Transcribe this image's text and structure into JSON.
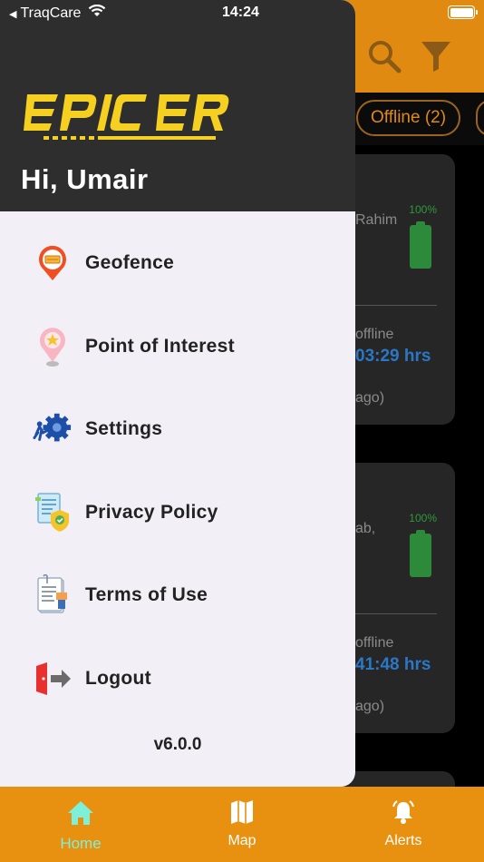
{
  "status_bar": {
    "back_app": "TraqCare",
    "time": "14:24"
  },
  "background": {
    "filter_chips": [
      {
        "label": "Offline (2)"
      }
    ],
    "cards": [
      {
        "address_partial": "Rahim",
        "battery_percent": "100%",
        "status": "offline",
        "duration": "03:29 hrs",
        "ago": "ago)"
      },
      {
        "address_partial": "ab,",
        "battery_percent": "100%",
        "status": "offline",
        "duration": "41:48 hrs",
        "ago": "ago)"
      }
    ]
  },
  "drawer": {
    "logo_text": "EPIC ERA",
    "greeting": "Hi, Umair",
    "menu": [
      {
        "label": "Geofence",
        "icon": "geofence-icon"
      },
      {
        "label": "Point of Interest",
        "icon": "poi-pin-icon"
      },
      {
        "label": "Settings",
        "icon": "settings-gear-icon"
      },
      {
        "label": "Privacy Policy",
        "icon": "privacy-shield-icon"
      },
      {
        "label": "Terms of Use",
        "icon": "terms-document-icon"
      },
      {
        "label": "Logout",
        "icon": "logout-icon"
      }
    ],
    "version": "v6.0.0"
  },
  "bottom_nav": {
    "items": [
      {
        "label": "Home",
        "icon": "home-icon",
        "active": true
      },
      {
        "label": "Map",
        "icon": "map-icon",
        "active": false
      },
      {
        "label": "Alerts",
        "icon": "bell-icon",
        "active": false
      }
    ]
  },
  "colors": {
    "accent_orange": "#E8900F",
    "drawer_header": "#2E2E2E",
    "drawer_bg": "#F2EFF6",
    "logo_yellow": "#F5D020",
    "active_nav": "#7FF0D8"
  }
}
